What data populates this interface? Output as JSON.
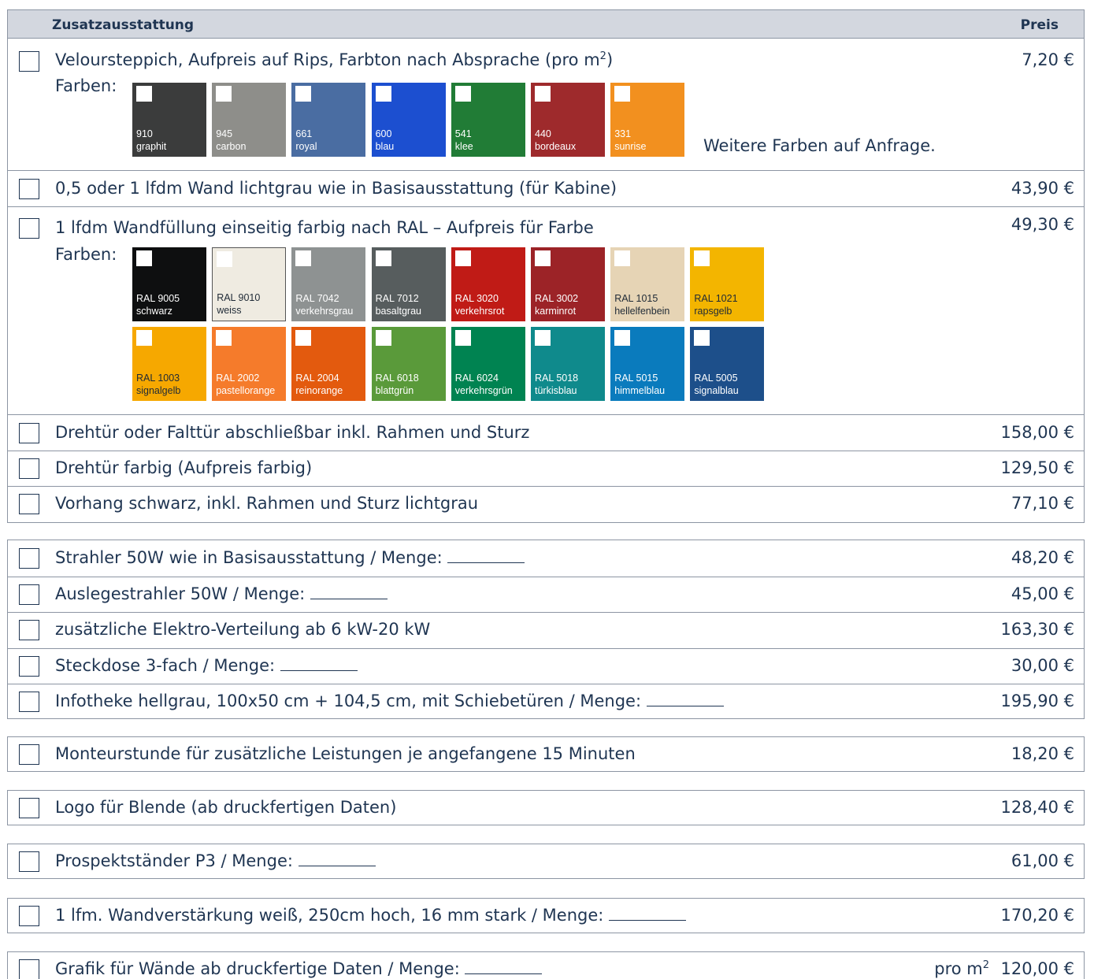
{
  "header": {
    "title": "Zusatzausstattung",
    "price": "Preis"
  },
  "group1": {
    "velour": {
      "label": "Veloursteppich, Aufpreis auf Rips, Farbton nach Absprache (pro m",
      "label_sup": "2",
      "label_end": ")",
      "price": "7,20 €",
      "farben_label": "Farben:",
      "more": "Weitere Farben auf Anfrage.",
      "swatches": [
        {
          "code": "910",
          "name": "graphit",
          "color": "#3b3c3c"
        },
        {
          "code": "945",
          "name": "carbon",
          "color": "#8e8e8a"
        },
        {
          "code": "661",
          "name": "royal",
          "color": "#4a6da2"
        },
        {
          "code": "600",
          "name": "blau",
          "color": "#1c4fd0"
        },
        {
          "code": "541",
          "name": "klee",
          "color": "#217c36"
        },
        {
          "code": "440",
          "name": "bordeaux",
          "color": "#9e2a2c"
        },
        {
          "code": "331",
          "name": "sunrise",
          "color": "#f2901f"
        }
      ]
    },
    "wand": {
      "label": "0,5 oder 1 lfdm Wand lichtgrau wie in Basisausstattung (für Kabine)",
      "price": "43,90 €"
    },
    "ral": {
      "label": "1 lfdm Wandfüllung einseitig farbig nach RAL – Aufpreis für Farbe",
      "price": "49,30 €",
      "farben_label": "Farben:",
      "row1": [
        {
          "code": "RAL 9005",
          "name": "schwarz",
          "color": "#0e0f10"
        },
        {
          "code": "RAL 9010",
          "name": "weiss",
          "color": "#efebe1"
        },
        {
          "code": "RAL 7042",
          "name": "verkehrsgrau",
          "color": "#8e9292"
        },
        {
          "code": "RAL 7012",
          "name": "basaltgrau",
          "color": "#575d5e"
        },
        {
          "code": "RAL 3020",
          "name": "verkehrsrot",
          "color": "#c01b16"
        },
        {
          "code": "RAL 3002",
          "name": "karminrot",
          "color": "#9c2327"
        },
        {
          "code": "RAL 1015",
          "name": "hellelfenbein",
          "color": "#e6d4b5"
        },
        {
          "code": "RAL 1021",
          "name": "rapsgelb",
          "color": "#f3b500"
        }
      ],
      "row2": [
        {
          "code": "RAL 1003",
          "name": "signalgelb",
          "color": "#f6a800"
        },
        {
          "code": "RAL 2002",
          "name": "pastellorange",
          "color": "#f57b2b"
        },
        {
          "code": "RAL 2004",
          "name": "reinorange",
          "color": "#e35a0e"
        },
        {
          "code": "RAL 6018",
          "name": "blattgrün",
          "color": "#5a9a3a"
        },
        {
          "code": "RAL 6024",
          "name": "verkehrsgrün",
          "color": "#008351"
        },
        {
          "code": "RAL 5018",
          "name": "türkisblau",
          "color": "#0f8a8c"
        },
        {
          "code": "RAL 5015",
          "name": "himmelblau",
          "color": "#0a7bbd"
        },
        {
          "code": "RAL 5005",
          "name": "signalblau",
          "color": "#1d4f8a"
        }
      ]
    },
    "drehtuer": {
      "label": "Drehtür oder Falttür abschließbar inkl. Rahmen und Sturz",
      "price": "158,00 €"
    },
    "drehtuer_farbig": {
      "label": "Drehtür farbig (Aufpreis farbig)",
      "price": "129,50 €"
    },
    "vorhang": {
      "label": "Vorhang schwarz, inkl. Rahmen und Sturz lichtgrau",
      "price": "77,10 €"
    }
  },
  "group2": [
    {
      "label": "Strahler 50W wie in Basisausstattung / Menge:",
      "blank": true,
      "price": "48,20 €"
    },
    {
      "label": "Auslegestrahler 50W / Menge:",
      "blank": true,
      "price": "45,00 €"
    },
    {
      "label": "zusätzliche Elektro-Verteilung ab 6 kW-20 kW",
      "blank": false,
      "price": "163,30 €"
    },
    {
      "label": "Steckdose 3-fach / Menge:",
      "blank": true,
      "price": "30,00 €"
    },
    {
      "label": "Infotheke hellgrau, 100x50 cm + 104,5 cm, mit Schiebetüren / Menge:",
      "blank": true,
      "price": "195,90 €"
    }
  ],
  "monteur": {
    "label": "Monteurstunde für zusätzliche Leistungen je angefangene 15 Minuten",
    "price": "18,20 €"
  },
  "logo": {
    "label": "Logo für Blende (ab druckfertigen Daten)",
    "price": "128,40 €"
  },
  "prospekt": {
    "label": "Prospektständer P3 / Menge:",
    "price": "61,00 €"
  },
  "wandverstaerkung": {
    "label": "1 lfm. Wandverstärkung weiß, 250cm hoch, 16 mm stark / Menge:",
    "price": "170,20 €"
  },
  "grafik": {
    "label": "Grafik für Wände ab druckfertige Daten / Menge:",
    "unit": "pro m",
    "unit_sup": "2",
    "price": "120,00 €"
  }
}
